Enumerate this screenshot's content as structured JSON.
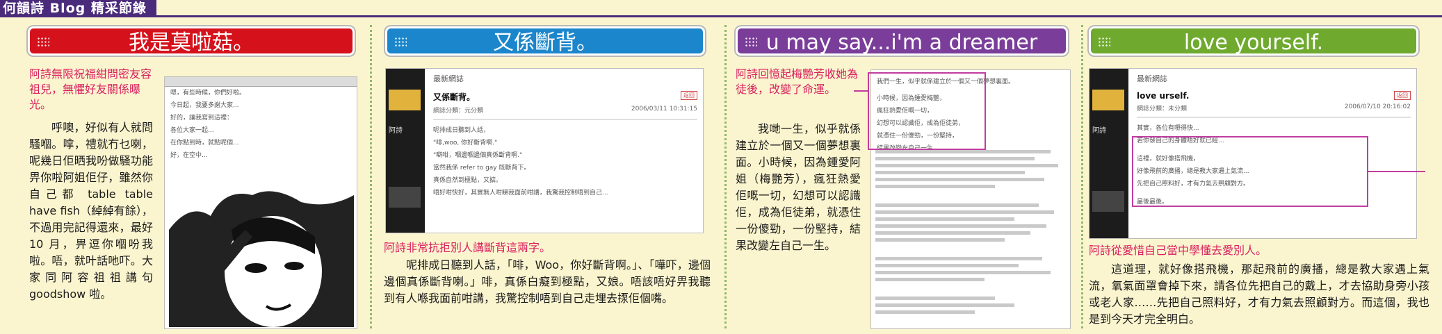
{
  "header": {
    "title": "何韻詩 Blog 精采節錄"
  },
  "colors": {
    "red": "#d5111b",
    "blue": "#1b86cc",
    "purple": "#7a3d9a",
    "green": "#6faa2f",
    "pink": "#d8205f",
    "highlight": "#c03ca0"
  },
  "sections": [
    {
      "title": "我是莫啦菇。",
      "lead": "阿詩無限祝福紺問密友容祖兒，無懼好友關係曝光。",
      "body": "呼噢，好似有人就問騷嗰。嗱，禮就冇乜喇，呢幾日佢晒我吩做騷功能畀你啦阿姐佢仔，雖然你自己都 table table have fish（綽綽有餘），不過用完記得還來，最好 10 月，畀逗你嗰吩我啦。唔，就叶話吔吓。大家同阿容祖祖講句 goodshow 啦。",
      "shot_text": [
        "嗯，有些時候，你們好啦。",
        "今日起，我要多謝大家...",
        "好的，讓我寫到這裡：",
        "各位大家一起...",
        "在你點到時，就點呢個...",
        "好，在空中..."
      ]
    },
    {
      "title": "又係斷背。",
      "shot": {
        "header": "最新網誌",
        "post_title": "又係斷背。",
        "button": "返回",
        "meta_left": "網誌分類：元分類",
        "meta_right": "2006/03/11 10:31:15",
        "text": [
          "呢排成日聽到人話，",
          "\"啡,woo, 你好斷背啊.\"",
          "\"噼咁，嗰邊嗰邊個真係斷背啊.\"",
          "當然我係 refer to gay 既斷背下。",
          "真係自然到極點，又掂。",
          "唔好咁快好，其實無人咁睇我面前咁講，我驚我控制唔到自己..."
        ]
      },
      "caption": "阿詩非常抗拒別人講斷背這兩字。",
      "body": "呢排成日聽到人話，「啡，Woo，你好斷背啊。」、「嘩吓，邊個邊個真係斷背喇。」啡，真係白癡到極點，又娘。唔該唔好畀我聽到有人喺我面前咁講，我驚控制唔到自己走埋去揼佢個嘴。"
    },
    {
      "title": "u may say...i'm a dreamer",
      "lead": "阿詩回憶起梅艷芳收她為徒後，改變了命運。",
      "body": "我哋一生，似乎就係建立於一個又一個夢想裏面。小時候，因為鍾愛阿姐（梅艷芳），瘋狂熱愛佢嘅一切，幻想可以認識佢，成為佢徒弟，就憑住一份傻勁，一份堅持，結果改變左自己一生。",
      "shot_text": [
        "我們一生，似乎就係建立於一個又一個夢想裏面。",
        "小時候，因為鍾愛梅艷，",
        "瘋狂熱愛佢嘅一切，",
        "幻想可以認識佢，成為佢徒弟，",
        "就憑住一份傻勁，一份堅持，",
        "結果改變左自己一生。"
      ]
    },
    {
      "title": "love yourself.",
      "shot": {
        "header": "最新網誌",
        "post_title": "love urself.",
        "button": "返回",
        "meta_left": "網誌分類：未分類",
        "meta_right": "2006/07/10 20:16:02",
        "text": [
          "其實，各位有嘢得快...",
          "若你發自己的身體唔好就已經...",
          "這裡，就好像搭飛機，",
          "好像飛前的廣播，總是教大家遇上氣流...",
          "先把自己照料好，才有力氣去照顧對方。",
          "最後最後。"
        ]
      },
      "caption": "阿詩從愛惜自己當中學懂去愛別人。",
      "body": "這道理，就好像搭飛機，那起飛前的廣播，總是教大家遇上氣流，氧氣面罩會掉下來，請各位先把自己的戴上，才去協助身旁小孩或老人家……先把自己照料好，才有力氣去照顧對方。而這個，我也是到今天才完全明白。"
    }
  ]
}
